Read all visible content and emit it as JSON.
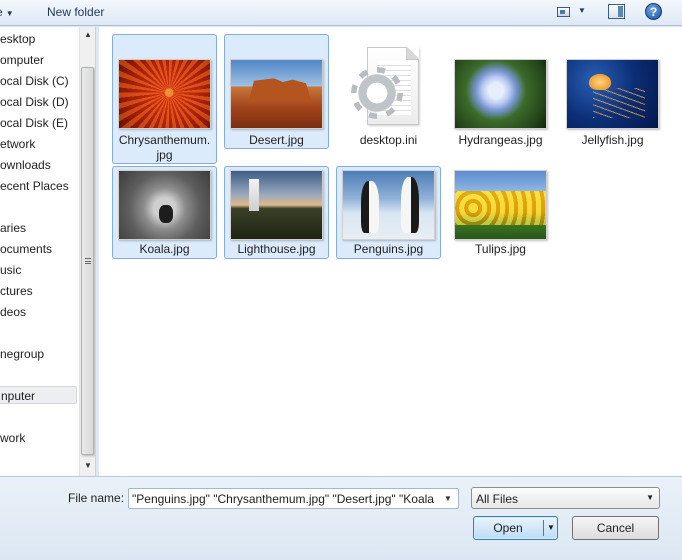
{
  "toolbar": {
    "organize_label": "e",
    "new_folder_label": "New folder",
    "help_label": "?"
  },
  "nav": {
    "items": [
      {
        "label": "esktop",
        "icon": "desktop-icon"
      },
      {
        "label": "omputer",
        "icon": "computer-icon"
      },
      {
        "label": "ocal Disk (C)",
        "icon": "drive-icon"
      },
      {
        "label": "ocal Disk (D)",
        "icon": "drive-icon"
      },
      {
        "label": "ocal Disk (E)",
        "icon": "drive-icon"
      },
      {
        "label": "etwork",
        "icon": "network-icon"
      },
      {
        "label": "ownloads",
        "icon": "downloads-icon"
      },
      {
        "label": "ecent Places",
        "icon": "recent-places-icon"
      },
      {
        "label": "aries",
        "icon": "libraries-icon"
      },
      {
        "label": "ocuments",
        "icon": "documents-icon"
      },
      {
        "label": "usic",
        "icon": "music-icon"
      },
      {
        "label": "ctures",
        "icon": "pictures-icon"
      },
      {
        "label": "deos",
        "icon": "videos-icon"
      },
      {
        "label": "negroup",
        "icon": "homegroup-icon"
      },
      {
        "label": "nputer",
        "icon": "computer-icon"
      },
      {
        "label": "work",
        "icon": "network-icon"
      }
    ]
  },
  "files": [
    {
      "name": "Chrysanthemum.\njpg",
      "line1": "Chrysanthemum.",
      "line2": "jpg",
      "selected": true,
      "kind": "image"
    },
    {
      "name": "Desert.jpg",
      "line1": "Desert.jpg",
      "line2": "",
      "selected": true,
      "kind": "image"
    },
    {
      "name": "desktop.ini",
      "line1": "desktop.ini",
      "line2": "",
      "selected": false,
      "kind": "settings-file"
    },
    {
      "name": "Hydrangeas.jpg",
      "line1": "Hydrangeas.jpg",
      "line2": "",
      "selected": false,
      "kind": "image"
    },
    {
      "name": "Jellyfish.jpg",
      "line1": "Jellyfish.jpg",
      "line2": "",
      "selected": false,
      "kind": "image"
    },
    {
      "name": "Koala.jpg",
      "line1": "Koala.jpg",
      "line2": "",
      "selected": true,
      "kind": "image"
    },
    {
      "name": "Lighthouse.jpg",
      "line1": "Lighthouse.jpg",
      "line2": "",
      "selected": true,
      "kind": "image"
    },
    {
      "name": "Penguins.jpg",
      "line1": "Penguins.jpg",
      "line2": "",
      "selected": true,
      "kind": "image"
    },
    {
      "name": "Tulips.jpg",
      "line1": "Tulips.jpg",
      "line2": "",
      "selected": false,
      "kind": "image"
    }
  ],
  "footer": {
    "file_name_label": "File name:",
    "file_name_value": "\"Penguins.jpg\" \"Chrysanthemum.jpg\" \"Desert.jpg\" \"Koala.",
    "file_type_value": "All Files",
    "open_label": "Open",
    "cancel_label": "Cancel"
  },
  "colors": {
    "selection_fill": "#dcebfc",
    "selection_border": "#84acdd",
    "toolbar_text": "#1e395b"
  }
}
